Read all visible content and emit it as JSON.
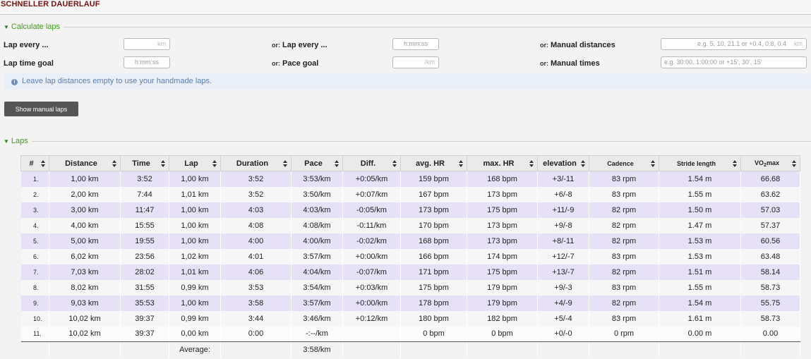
{
  "app": {
    "title": "SCHNELLER DAUERLAUF"
  },
  "calc": {
    "section_label": "Calculate laps",
    "lap_every_label": "Lap every ...",
    "lap_every_unit": "km",
    "or_label": "or:",
    "lap_every2_label": "Lap every ...",
    "lap_every2_placeholder": "h:mm:ss",
    "manual_distances_label": "Manual distances",
    "manual_distances_placeholder": "e.g. 5, 10, 21.1 or +0.4, 0.8, 0.4",
    "manual_distances_unit": "km",
    "lap_time_goal_label": "Lap time goal",
    "lap_time_goal_placeholder": "h:mm:ss",
    "pace_goal_label": "Pace goal",
    "pace_goal_unit": "/km",
    "manual_times_label": "Manual times",
    "manual_times_placeholder": "e.g. 30:00, 1:00:00 or +15', 30', 15'"
  },
  "info": {
    "text": "Leave lap distances empty to use your handmade laps."
  },
  "buttons": {
    "show_manual_laps": "Show manual laps"
  },
  "laps": {
    "section_label": "Laps",
    "headers": {
      "num": "#",
      "distance": "Distance",
      "time": "Time",
      "lap": "Lap",
      "duration": "Duration",
      "pace": "Pace",
      "diff": "Diff.",
      "avg_hr": "avg. HR",
      "max_hr": "max. HR",
      "elevation": "elevation",
      "cadence": "Cadence",
      "stride": "Stride length",
      "vo2_prefix": "VO",
      "vo2_sub": "2",
      "vo2_suffix": "max"
    },
    "rows": [
      {
        "num": "1.",
        "distance": "1,00 km",
        "time": "3:52",
        "lap": "1,00 km",
        "duration": "3:52",
        "pace": "3:53/km",
        "diff": "+0:05/km",
        "avg_hr": "159 bpm",
        "max_hr": "168 bpm",
        "elevation": "+3/-11",
        "cadence": "83 rpm",
        "stride": "1.54 m",
        "vo2": "66.68"
      },
      {
        "num": "2.",
        "distance": "2,00 km",
        "time": "7:44",
        "lap": "1,01 km",
        "duration": "3:52",
        "pace": "3:50/km",
        "diff": "+0:07/km",
        "avg_hr": "167 bpm",
        "max_hr": "173 bpm",
        "elevation": "+6/-8",
        "cadence": "83 rpm",
        "stride": "1.55 m",
        "vo2": "63.62"
      },
      {
        "num": "3.",
        "distance": "3,00 km",
        "time": "11:47",
        "lap": "1,00 km",
        "duration": "4:03",
        "pace": "4:03/km",
        "diff": "-0:05/km",
        "avg_hr": "173 bpm",
        "max_hr": "175 bpm",
        "elevation": "+11/-9",
        "cadence": "82 rpm",
        "stride": "1.50 m",
        "vo2": "57.03"
      },
      {
        "num": "4.",
        "distance": "4,00 km",
        "time": "15:55",
        "lap": "1,00 km",
        "duration": "4:08",
        "pace": "4:08/km",
        "diff": "-0:11/km",
        "avg_hr": "170 bpm",
        "max_hr": "173 bpm",
        "elevation": "+9/-8",
        "cadence": "82 rpm",
        "stride": "1.47 m",
        "vo2": "57.37"
      },
      {
        "num": "5.",
        "distance": "5,00 km",
        "time": "19:55",
        "lap": "1,00 km",
        "duration": "4:00",
        "pace": "4:00/km",
        "diff": "-0:02/km",
        "avg_hr": "168 bpm",
        "max_hr": "173 bpm",
        "elevation": "+8/-11",
        "cadence": "82 rpm",
        "stride": "1.53 m",
        "vo2": "60.56"
      },
      {
        "num": "6.",
        "distance": "6,02 km",
        "time": "23:56",
        "lap": "1,02 km",
        "duration": "4:01",
        "pace": "3:57/km",
        "diff": "+0:00/km",
        "avg_hr": "166 bpm",
        "max_hr": "174 bpm",
        "elevation": "+12/-7",
        "cadence": "83 rpm",
        "stride": "1.53 m",
        "vo2": "63.48"
      },
      {
        "num": "7.",
        "distance": "7,03 km",
        "time": "28:02",
        "lap": "1,01 km",
        "duration": "4:06",
        "pace": "4:04/km",
        "diff": "-0:07/km",
        "avg_hr": "171 bpm",
        "max_hr": "175 bpm",
        "elevation": "+13/-7",
        "cadence": "82 rpm",
        "stride": "1.51 m",
        "vo2": "58.14"
      },
      {
        "num": "8.",
        "distance": "8,02 km",
        "time": "31:55",
        "lap": "0,99 km",
        "duration": "3:53",
        "pace": "3:54/km",
        "diff": "+0:03/km",
        "avg_hr": "175 bpm",
        "max_hr": "179 bpm",
        "elevation": "+9/-3",
        "cadence": "83 rpm",
        "stride": "1.55 m",
        "vo2": "58.73"
      },
      {
        "num": "9.",
        "distance": "9,03 km",
        "time": "35:53",
        "lap": "1,00 km",
        "duration": "3:58",
        "pace": "3:57/km",
        "diff": "+0:00/km",
        "avg_hr": "178 bpm",
        "max_hr": "179 bpm",
        "elevation": "+4/-9",
        "cadence": "82 rpm",
        "stride": "1.54 m",
        "vo2": "55.75"
      },
      {
        "num": "10.",
        "distance": "10,02 km",
        "time": "39:37",
        "lap": "0,99 km",
        "duration": "3:44",
        "pace": "3:46/km",
        "diff": "+0:12/km",
        "avg_hr": "180 bpm",
        "max_hr": "182 bpm",
        "elevation": "+5/-4",
        "cadence": "83 rpm",
        "stride": "1.61 m",
        "vo2": "58.73"
      },
      {
        "num": "11.",
        "distance": "10,02 km",
        "time": "39:37",
        "lap": "0,00 km",
        "duration": "0:00",
        "pace": "-:--/km",
        "diff": "",
        "avg_hr": "0 bpm",
        "max_hr": "0 bpm",
        "elevation": "+0/-0",
        "cadence": "0 rpm",
        "stride": "0.00 m",
        "vo2": "0.00"
      }
    ],
    "average": {
      "label": "Average:",
      "pace": "3:58/km"
    }
  },
  "colors": {
    "positive": "#2fa01e",
    "negative": "#c8161d",
    "row_odd": "#e6e1f7",
    "accent": "#3f9b1e"
  }
}
